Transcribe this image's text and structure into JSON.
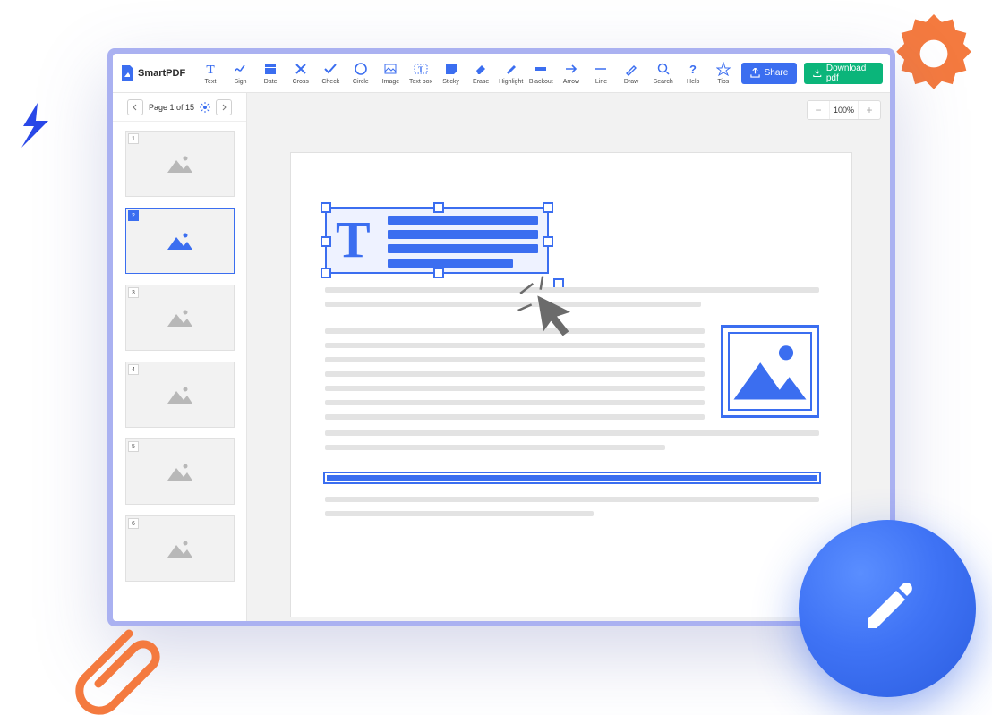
{
  "app": {
    "name": "SmartPDF"
  },
  "toolbar": {
    "tools": [
      {
        "id": "text",
        "label": "Text"
      },
      {
        "id": "sign",
        "label": "Sign"
      },
      {
        "id": "date",
        "label": "Date"
      },
      {
        "id": "cross",
        "label": "Cross"
      },
      {
        "id": "check",
        "label": "Check"
      },
      {
        "id": "circle",
        "label": "Circle"
      },
      {
        "id": "image",
        "label": "Image"
      },
      {
        "id": "textbox",
        "label": "Text box"
      },
      {
        "id": "sticky",
        "label": "Sticky"
      },
      {
        "id": "erase",
        "label": "Erase"
      },
      {
        "id": "highlight",
        "label": "Highlight"
      },
      {
        "id": "blackout",
        "label": "Blackout"
      },
      {
        "id": "arrow",
        "label": "Arrow"
      },
      {
        "id": "line",
        "label": "Line"
      },
      {
        "id": "draw",
        "label": "Draw"
      }
    ],
    "util": [
      {
        "id": "search",
        "label": "Search"
      },
      {
        "id": "help",
        "label": "Help"
      },
      {
        "id": "tips",
        "label": "Tips"
      }
    ],
    "share": "Share",
    "download": "Download pdf"
  },
  "pager": {
    "label": "Page 1 of 15",
    "current": 1,
    "total": 15
  },
  "thumbs": [
    {
      "n": "1",
      "active": false
    },
    {
      "n": "2",
      "active": true
    },
    {
      "n": "3",
      "active": false
    },
    {
      "n": "4",
      "active": false
    },
    {
      "n": "5",
      "active": false
    },
    {
      "n": "6",
      "active": false
    }
  ],
  "zoom": {
    "value": "100%"
  },
  "colors": {
    "primary": "#3b6ef0",
    "success": "#0bb57a",
    "accent_orange": "#f47a3f"
  }
}
